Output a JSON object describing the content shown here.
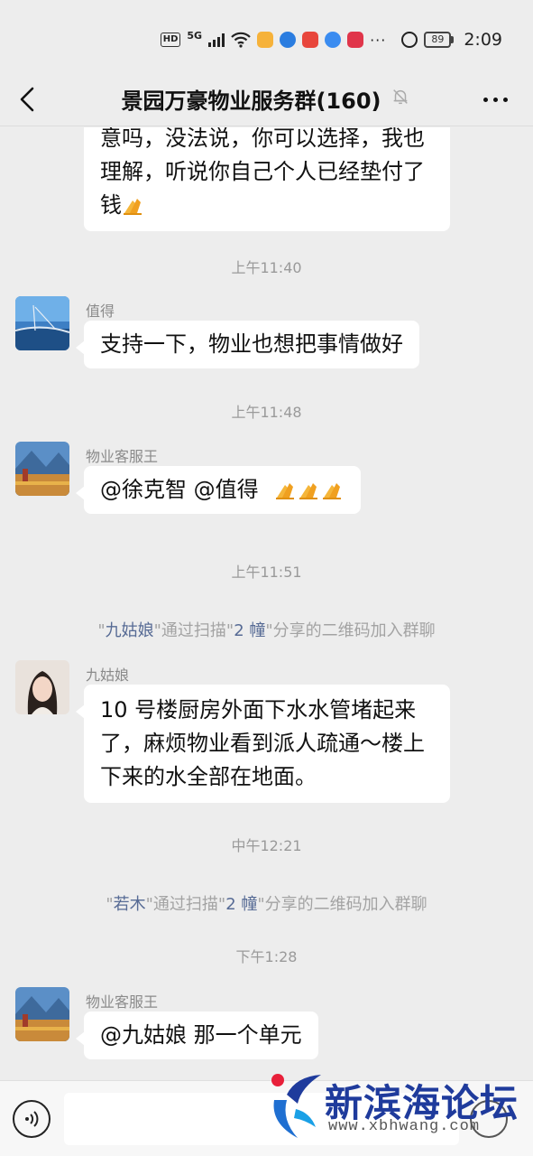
{
  "status_bar": {
    "hd": "HD",
    "network": "5G",
    "dots": "···",
    "battery": "89",
    "time": "2:09",
    "icons": [
      "signal-icon",
      "wifi-icon",
      "app-notification-icon",
      "alarm-icon",
      "battery-icon"
    ]
  },
  "header": {
    "title": "景园万豪物业服务群(160)",
    "icons": [
      "back-icon",
      "mute-icon",
      "more-icon"
    ]
  },
  "messages": [
    {
      "id": "m0",
      "lines": [
        "意吗，没法说，你可以选择，我也",
        "理解，听说你自己个人已经垫付了",
        "钱"
      ],
      "emoji": "pray-icon"
    },
    {
      "id": "t1",
      "type": "time",
      "text": "上午11:40"
    },
    {
      "id": "m1",
      "sender": "值得",
      "text": "支持一下，物业也想把事情做好"
    },
    {
      "id": "t2",
      "type": "time",
      "text": "上午11:48"
    },
    {
      "id": "m2",
      "sender": "物业客服王",
      "text": "@徐克智  @值得",
      "emoji_count": 3
    },
    {
      "id": "t3",
      "type": "time",
      "text": "上午11:51"
    },
    {
      "id": "s1",
      "type": "system",
      "q1": "\"",
      "name": "九姑娘",
      "mid": "\"通过扫描\"",
      "group": "2 幢",
      "tail": "\"分享的二维码加入群聊"
    },
    {
      "id": "m3",
      "sender": "九姑娘",
      "lines": [
        "10 号楼厨房外面下水水管堵起来",
        "了，麻烦物业看到派人疏通～楼上",
        "下来的水全部在地面。"
      ]
    },
    {
      "id": "t4",
      "type": "time",
      "text": "中午12:21"
    },
    {
      "id": "s2",
      "type": "system",
      "q1": "\"",
      "name": "若木",
      "mid": "\"通过扫描\"",
      "group": "2 幢",
      "tail": "\"分享的二维码加入群聊"
    },
    {
      "id": "t5",
      "type": "time",
      "text": "下午1:28"
    },
    {
      "id": "m4",
      "sender": "物业客服王",
      "text": "@九姑娘  那一个单元"
    }
  ],
  "input_bar": {
    "placeholder": "",
    "icons": [
      "voice-icon",
      "emoji-icon"
    ]
  },
  "watermark": {
    "title": "新滨海论坛",
    "url": "www.xbhwang.com"
  },
  "colors": {
    "background": "#ededed",
    "bubble": "#ffffff",
    "link_name": "#576b95",
    "watermark_blue": "#1f3b9c"
  }
}
